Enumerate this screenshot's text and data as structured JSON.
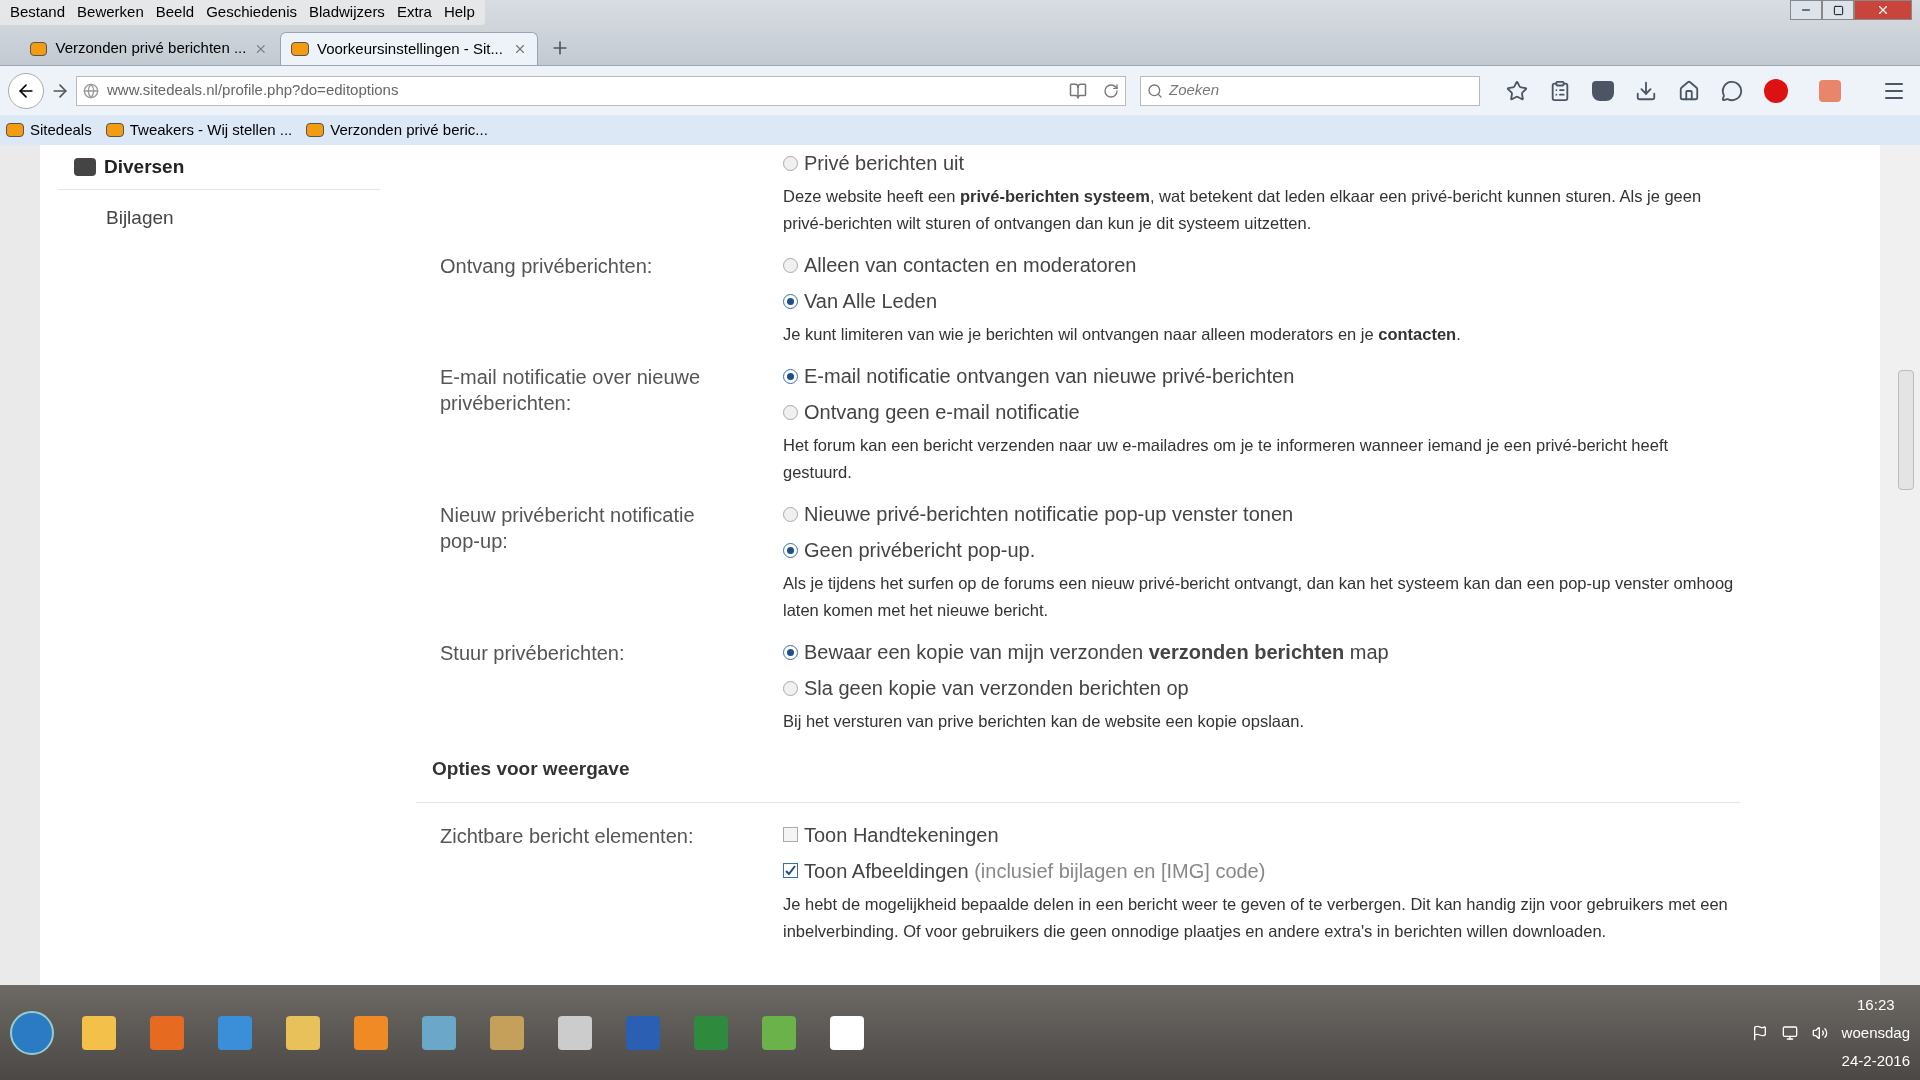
{
  "menu": [
    "Bestand",
    "Bewerken",
    "Beeld",
    "Geschiedenis",
    "Bladwijzers",
    "Extra",
    "Help"
  ],
  "tabs": [
    {
      "label": "Verzonden privé berichten ...",
      "selected": false
    },
    {
      "label": "Voorkeursinstellingen - Sit...",
      "selected": true
    }
  ],
  "address": {
    "url": "www.sitedeals.nl/profile.php?do=editoptions"
  },
  "search": {
    "placeholder": "Zoeken"
  },
  "bookmarks": [
    "Sitedeals",
    "Tweakers - Wij stellen ...",
    "Verzonden privé beric..."
  ],
  "sidebar": {
    "heading": "Diversen",
    "items": [
      "Bijlagen"
    ]
  },
  "settings": [
    {
      "options": [
        {
          "kind": "radio",
          "label": "Privé berichten uit",
          "selected": false
        }
      ],
      "description": "Deze website heeft een **privé-berichten systeem**, wat betekent dat leden elkaar een privé-bericht kunnen sturen. Als je geen privé-berichten wilt sturen of ontvangen dan kun je dit systeem uitzetten."
    },
    {
      "label": "Ontvang privéberichten:",
      "options": [
        {
          "kind": "radio",
          "label": "Alleen van contacten en moderatoren",
          "selected": false
        },
        {
          "kind": "radio",
          "label": "Van Alle Leden",
          "selected": true
        }
      ],
      "description": "Je kunt limiteren van wie je berichten wil ontvangen naar alleen moderators en je **contacten**."
    },
    {
      "label": "E-mail notificatie over nieuwe privéberichten:",
      "options": [
        {
          "kind": "radio",
          "label": "E-mail notificatie ontvangen van nieuwe privé-berichten",
          "selected": true
        },
        {
          "kind": "radio",
          "label": "Ontvang geen e-mail notificatie",
          "selected": false
        }
      ],
      "description": "Het forum kan een bericht verzenden naar uw e-mailadres om je te informeren wanneer iemand je een privé-bericht heeft gestuurd."
    },
    {
      "label": "Nieuw privébericht notificatie pop-up:",
      "options": [
        {
          "kind": "radio",
          "label": "Nieuwe privé-berichten notificatie pop-up venster tonen",
          "selected": false
        },
        {
          "kind": "radio",
          "label": "Geen privébericht pop-up.",
          "selected": true
        }
      ],
      "description": "Als je tijdens het surfen op de forums een nieuw privé-bericht ontvangt, dan kan het systeem kan dan een pop-up venster omhoog laten komen met het nieuwe bericht."
    },
    {
      "label": "Stuur privéberichten:",
      "options": [
        {
          "kind": "radio",
          "label": "Bewaar een kopie van mijn verzonden **verzonden berichten** map",
          "selected": true
        },
        {
          "kind": "radio",
          "label": "Sla geen kopie van verzonden berichten op",
          "selected": false
        }
      ],
      "description": "Bij het versturen van prive berichten kan de website een kopie opslaan."
    },
    {
      "section": "Opties voor weergave"
    },
    {
      "label": "Zichtbare bericht elementen:",
      "options": [
        {
          "kind": "checkbox",
          "label": "Toon Handtekeningen",
          "checked": false
        },
        {
          "kind": "checkbox",
          "label": "Toon Afbeeldingen",
          "note": "(inclusief bijlagen en [IMG] code)",
          "checked": true
        }
      ],
      "description": "Je hebt de mogelijkheid bepaalde delen in een bericht weer te geven of te verbergen. Dit kan handig zijn voor gebruikers met een inbelverbinding. Of voor gebruikers die geen onnodige plaatjes en andere extra's in berichten willen downloaden."
    }
  ],
  "clock": {
    "time": "16:23",
    "day": "woensdag",
    "date": "24-2-2016"
  }
}
